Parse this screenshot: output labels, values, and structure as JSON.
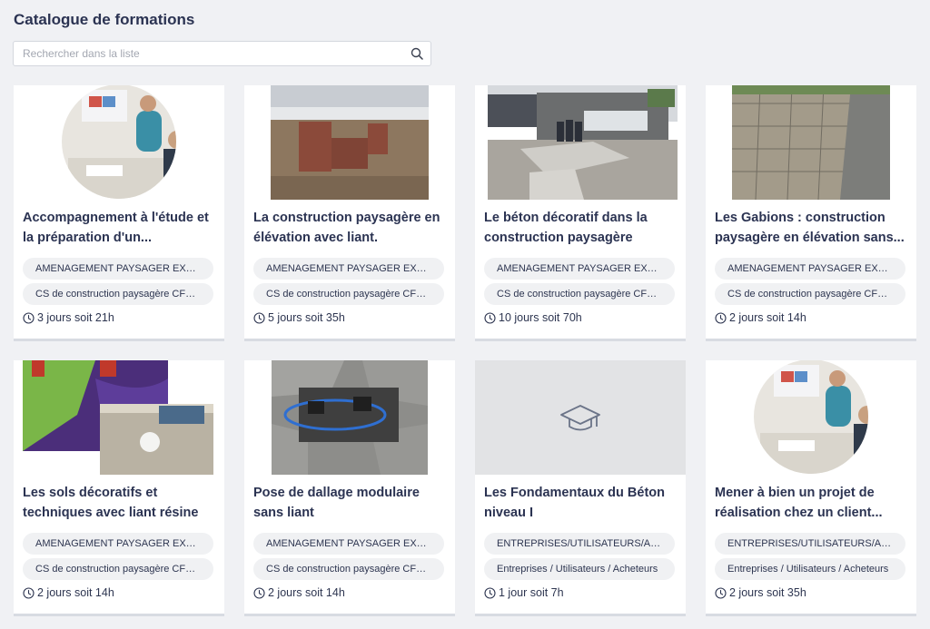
{
  "page": {
    "title": "Catalogue de formations"
  },
  "search": {
    "placeholder": "Rechercher dans la liste",
    "icon": "search-icon"
  },
  "cards": [
    {
      "title": "Accompagnement à l'étude et la préparation d'un...",
      "tag1": "AMENAGEMENT PAYSAGER EXTERIEUR",
      "tag2": "CS de construction paysagère CFPPA",
      "duration": "3 jours soit 21h",
      "image": "trainer-circle"
    },
    {
      "title": "La construction paysagère en élévation avec liant.",
      "tag1": "AMENAGEMENT PAYSAGER EXTERIEUR",
      "tag2": "CS de construction paysagère CFPPA",
      "duration": "5 jours soit 35h",
      "image": "brick-walls"
    },
    {
      "title": "Le béton décoratif dans la construction paysagère",
      "tag1": "AMENAGEMENT PAYSAGER EXTERIEUR",
      "tag2": "CS de construction paysagère CFPPA",
      "duration": "10 jours soit 70h",
      "image": "building-group"
    },
    {
      "title": "Les Gabions : construction paysagère en élévation sans...",
      "tag1": "AMENAGEMENT PAYSAGER EXTERIEUR",
      "tag2": "CS de construction paysagère CFPPA",
      "duration": "2 jours soit 14h",
      "image": "gabion-wall"
    },
    {
      "title": "Les sols décoratifs et techniques avec liant résine",
      "tag1": "AMENAGEMENT PAYSAGER EXTERIEUR",
      "tag2": "CS de construction paysagère CFPPA",
      "duration": "2 jours soit 14h",
      "image": "resin-floor"
    },
    {
      "title": "Pose de dallage modulaire sans liant",
      "tag1": "AMENAGEMENT PAYSAGER EXTERIEUR",
      "tag2": "CS de construction paysagère CFPPA",
      "duration": "2 jours soit 14h",
      "image": "modular-paving"
    },
    {
      "title": "Les Fondamentaux du Béton niveau I",
      "tag1": "ENTREPRISES/UTILISATEURS/ACHETEURS",
      "tag2": "Entreprises / Utilisateurs / Acheteurs",
      "duration": "1 jour soit 7h",
      "image": "graduation-cap-placeholder"
    },
    {
      "title": "Mener à bien un projet de réalisation chez un client...",
      "tag1": "ENTREPRISES/UTILISATEURS/ACHETEURS",
      "tag2": "Entreprises / Utilisateurs / Acheteurs",
      "duration": "2 jours soit 35h",
      "image": "trainer-circle"
    }
  ],
  "colors": {
    "background": "#f0f1f4",
    "card": "#ffffff",
    "tag": "#f0f1f3",
    "title": "#2b3352"
  }
}
